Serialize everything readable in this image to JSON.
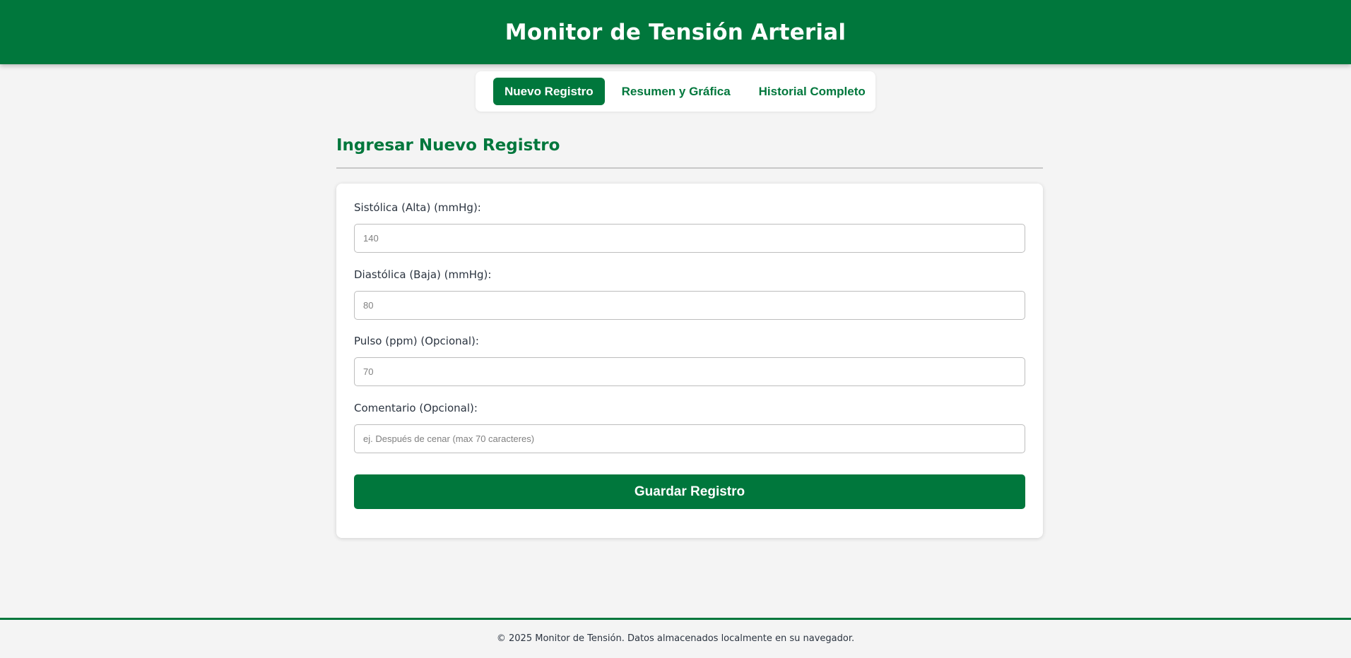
{
  "header": {
    "title": "Monitor de Tensión Arterial"
  },
  "tabs": [
    {
      "label": "Nuevo Registro",
      "active": true
    },
    {
      "label": "Resumen y Gráfica",
      "active": false
    },
    {
      "label": "Historial Completo",
      "active": false
    }
  ],
  "section": {
    "title": "Ingresar Nuevo Registro"
  },
  "form": {
    "fields": [
      {
        "label": "Sistólica (Alta) (mmHg):",
        "placeholder": "140",
        "value": ""
      },
      {
        "label": "Diastólica (Baja) (mmHg):",
        "placeholder": "80",
        "value": ""
      },
      {
        "label": "Pulso (ppm) (Opcional):",
        "placeholder": "70",
        "value": ""
      },
      {
        "label": "Comentario (Opcional):",
        "placeholder": "ej. Después de cenar (max 70 caracteres)",
        "value": ""
      }
    ],
    "submit_label": "Guardar Registro"
  },
  "footer": {
    "text": "© 2025 Monitor de Tensión. Datos almacenados localmente en su navegador."
  },
  "colors": {
    "primary": "#00773c",
    "background": "#f4f4f4",
    "text": "#2b3440"
  }
}
